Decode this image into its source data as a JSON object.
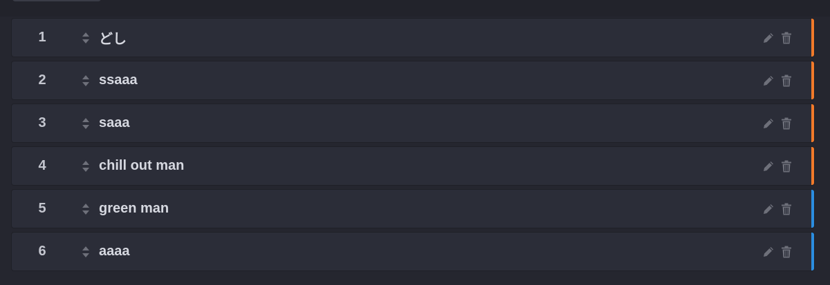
{
  "colors": {
    "orange": "#f27a2a",
    "blue": "#2b8de0",
    "icon": "#6e707a"
  },
  "items": [
    {
      "number": "1",
      "label": "どし",
      "accent": "orange"
    },
    {
      "number": "2",
      "label": "ssaaa",
      "accent": "orange"
    },
    {
      "number": "3",
      "label": "saaa",
      "accent": "orange"
    },
    {
      "number": "4",
      "label": "chill out man",
      "accent": "orange"
    },
    {
      "number": "5",
      "label": "green man",
      "accent": "blue"
    },
    {
      "number": "6",
      "label": "aaaa",
      "accent": "blue"
    }
  ],
  "icons": {
    "handle": "sort-handle-icon",
    "edit": "pencil-icon",
    "delete": "trash-icon"
  }
}
